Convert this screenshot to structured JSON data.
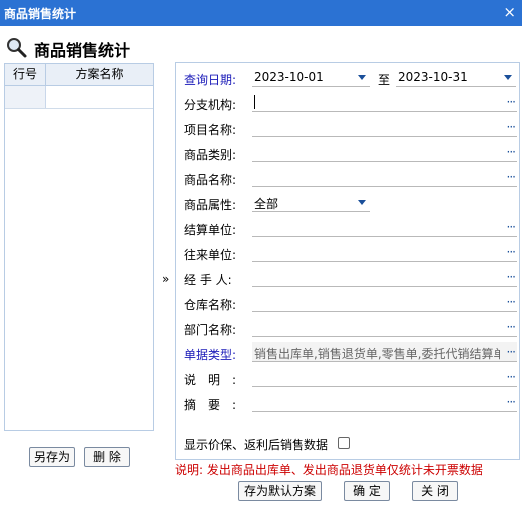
{
  "window": {
    "title": "商品销售统计",
    "close_glyph": "×"
  },
  "heading": {
    "icon": "magnifier-icon",
    "text": "商品销售统计"
  },
  "plan_list": {
    "col_row": "行号",
    "col_name": "方案名称",
    "rows": [
      {
        "no": "",
        "name": ""
      }
    ]
  },
  "plan_buttons": {
    "save_as": "另存为",
    "delete": "删 除"
  },
  "splitter": "»",
  "form": {
    "date_label": "查询日期:",
    "date_from": "2023-10-01",
    "date_to_sep": "至",
    "date_to": "2023-10-31",
    "branch_label": "分支机构:",
    "branch_value": "",
    "project_label": "项目名称:",
    "project_value": "",
    "category_label": "商品类别:",
    "category_value": "",
    "product_label": "商品名称:",
    "product_value": "",
    "attr_label": "商品属性:",
    "attr_value": "全部",
    "settle_label": "结算单位:",
    "settle_value": "",
    "partner_label": "往来单位:",
    "partner_value": "",
    "handler_label": "经 手 人:",
    "handler_value": "",
    "warehouse_label": "仓库名称:",
    "warehouse_value": "",
    "dept_label": "部门名称:",
    "dept_value": "",
    "doctype_label": "单据类型:",
    "doctype_value": "销售出库单,销售退货单,零售单,委托代销结算单",
    "desc_label": "说　明　:",
    "desc_value": "",
    "summary_label": "摘　要　:",
    "summary_value": "",
    "ellipsis": "···",
    "show_checkbox_label": "显示价保、返利后销售数据",
    "show_checkbox_checked": false
  },
  "note": "说明: 发出商品出库单、发出商品退货单仅统计未开票数据",
  "bottom_buttons": {
    "save_default": "存为默认方案",
    "ok": "确 定",
    "close": "关 闭"
  },
  "colors": {
    "titlebar": "#2b72d3",
    "label_link": "#1a1ab8",
    "note": "#cc0000"
  }
}
